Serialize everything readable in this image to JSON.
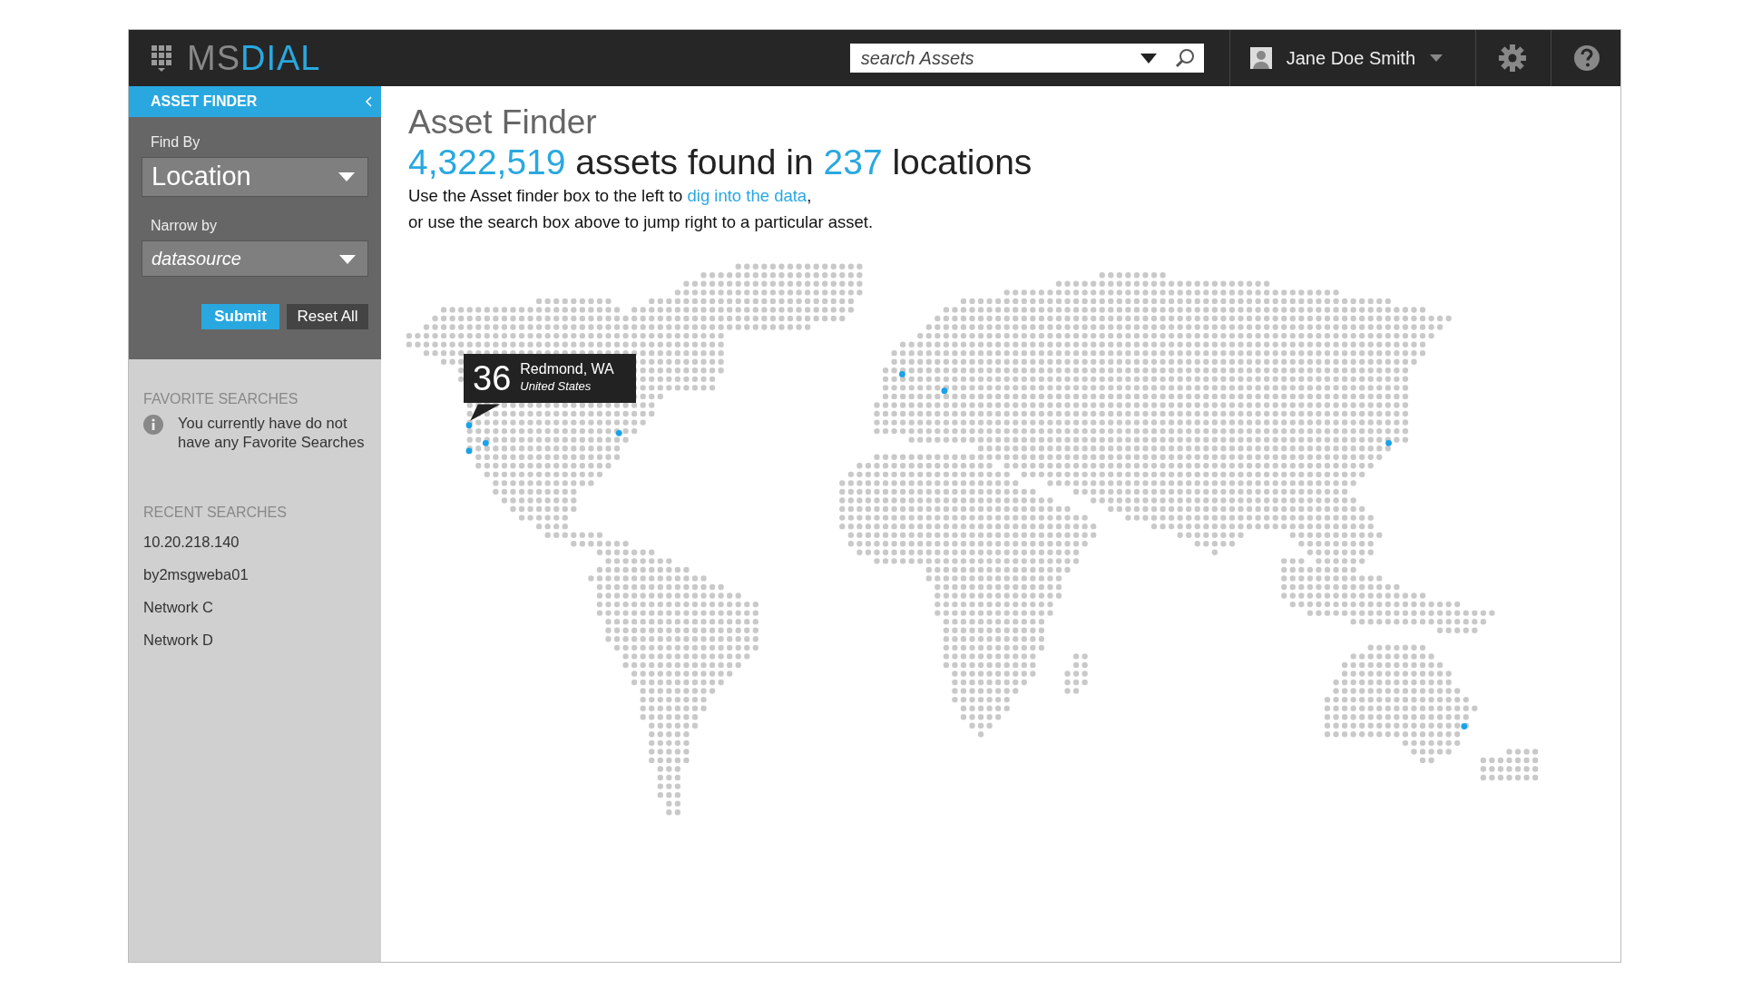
{
  "top_bar": {
    "logo": [
      {
        "text": "MS",
        "accent": false
      },
      {
        "text": "DIAL",
        "accent": true
      }
    ],
    "search": {
      "placeholder": "search Assets"
    },
    "user": {
      "name": "Jane Doe Smith"
    }
  },
  "sidebar": {
    "header": "ASSET FINDER",
    "find_by": {
      "label": "Find By",
      "value": "Location"
    },
    "narrow_by": {
      "label": "Narrow by",
      "placeholder": "datasource"
    },
    "buttons": [
      {
        "label": "Submit",
        "kind": "primary"
      },
      {
        "label": "Reset All",
        "kind": "secondary"
      }
    ],
    "favorites": {
      "heading": "FAVORITE SEARCHES",
      "message": "You currently have do not have any Favorite Searches"
    },
    "recent": {
      "heading": "RECENT SEARCHES",
      "items": [
        "10.20.218.140",
        "by2msgweba01",
        "Network C",
        "Network D"
      ]
    }
  },
  "main": {
    "title": "Asset Finder",
    "headline": [
      {
        "text": "4,322,519",
        "accent": true
      },
      {
        "text": " assets found in ",
        "accent": false
      },
      {
        "text": "237",
        "accent": true
      },
      {
        "text": " locations",
        "accent": false
      }
    ],
    "intro": [
      {
        "kind": "text",
        "text": "Use the Asset finder box to the left to "
      },
      {
        "kind": "link",
        "text": "dig into the data"
      },
      {
        "kind": "text",
        "text": ","
      },
      {
        "kind": "break"
      },
      {
        "kind": "text",
        "text": "or use the search box above to jump right to a particular asset."
      }
    ],
    "tooltip": {
      "count": "36",
      "place": "Redmond, WA",
      "country": "United States"
    }
  }
}
